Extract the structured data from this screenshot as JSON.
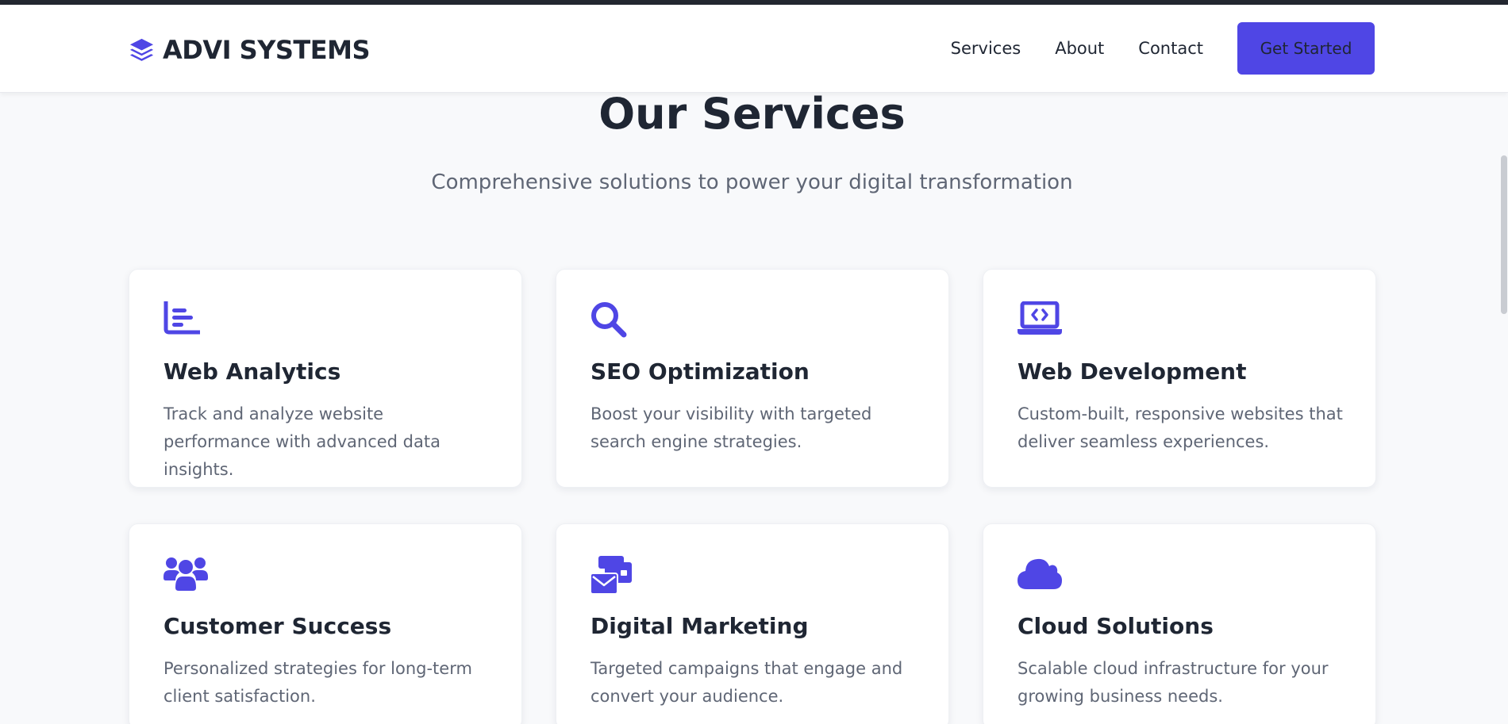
{
  "brand": {
    "name": "ADVI SYSTEMS",
    "icon": "layers-icon"
  },
  "nav": {
    "links": [
      "Services",
      "About",
      "Contact"
    ],
    "cta_label": "Get Started"
  },
  "section": {
    "title": "Our Services",
    "subtitle": "Comprehensive solutions to power your digital transformation"
  },
  "services": [
    {
      "icon": "chart-icon",
      "title": "Web Analytics",
      "description": "Track and analyze website performance with advanced data insights."
    },
    {
      "icon": "search-icon",
      "title": "SEO Optimization",
      "description": "Boost your visibility with targeted search engine strategies."
    },
    {
      "icon": "laptop-code-icon",
      "title": "Web Development",
      "description": "Custom-built, responsive websites that deliver seamless experiences."
    },
    {
      "icon": "users-icon",
      "title": "Customer Success",
      "description": "Personalized strategies for long-term client satisfaction."
    },
    {
      "icon": "mail-bulk-icon",
      "title": "Digital Marketing",
      "description": "Targeted campaigns that engage and convert your audience."
    },
    {
      "icon": "cloud-icon",
      "title": "Cloud Solutions",
      "description": "Scalable cloud infrastructure for your growing business needs."
    }
  ],
  "colors": {
    "accent": "#4f46e5",
    "text": "#1f2633",
    "muted": "#5f6675",
    "background": "#f8f9fb"
  }
}
